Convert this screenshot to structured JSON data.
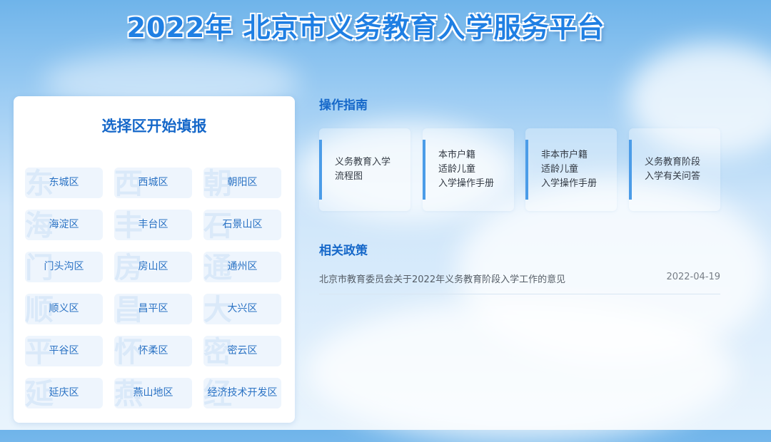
{
  "header": {
    "title": "2022年 北京市义务教育入学服务平台"
  },
  "district_panel": {
    "title": "选择区开始填报",
    "districts": [
      {
        "label": "东城区",
        "ghost": "东"
      },
      {
        "label": "西城区",
        "ghost": "西"
      },
      {
        "label": "朝阳区",
        "ghost": "朝"
      },
      {
        "label": "海淀区",
        "ghost": "海"
      },
      {
        "label": "丰台区",
        "ghost": "丰"
      },
      {
        "label": "石景山区",
        "ghost": "石"
      },
      {
        "label": "门头沟区",
        "ghost": "门"
      },
      {
        "label": "房山区",
        "ghost": "房"
      },
      {
        "label": "通州区",
        "ghost": "通"
      },
      {
        "label": "顺义区",
        "ghost": "顺"
      },
      {
        "label": "昌平区",
        "ghost": "昌"
      },
      {
        "label": "大兴区",
        "ghost": "大"
      },
      {
        "label": "平谷区",
        "ghost": "平"
      },
      {
        "label": "怀柔区",
        "ghost": "怀"
      },
      {
        "label": "密云区",
        "ghost": "密"
      },
      {
        "label": "延庆区",
        "ghost": "延"
      },
      {
        "label": "燕山地区",
        "ghost": "燕"
      },
      {
        "label": "经济技术开发区",
        "ghost": "经"
      }
    ]
  },
  "guide": {
    "heading": "操作指南",
    "cards": [
      {
        "line1": "义务教育入学",
        "line2": "流程图",
        "line3": ""
      },
      {
        "line1": "本市户籍",
        "line2": "适龄儿童",
        "line3": "入学操作手册"
      },
      {
        "line1": "非本市户籍",
        "line2": "适龄儿童",
        "line3": "入学操作手册"
      },
      {
        "line1": "义务教育阶段",
        "line2": "入学有关问答",
        "line3": ""
      }
    ]
  },
  "policy": {
    "heading": "相关政策",
    "items": [
      {
        "title": "北京市教育委员会关于2022年义务教育阶段入学工作的意见",
        "date": "2022-04-19"
      }
    ]
  },
  "colors": {
    "brand_blue": "#1668c9",
    "district_text": "#2a72c4",
    "accent_bar": "#4b9ce8"
  }
}
